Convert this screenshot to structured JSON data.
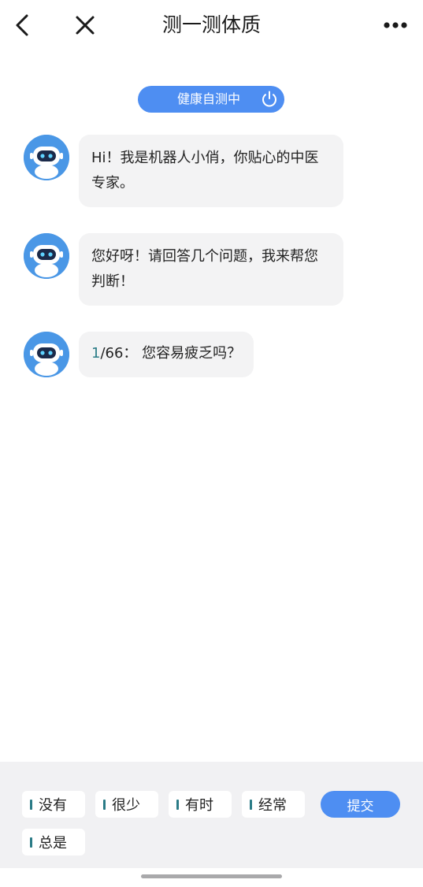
{
  "header": {
    "title": "测一测体质",
    "back_icon": "back-chevron-icon",
    "close_icon": "close-icon",
    "more_icon": "more-dots-icon"
  },
  "status": {
    "label": "健康自测中",
    "icon": "power-icon",
    "color": "#4e8ef2"
  },
  "messages": [
    {
      "sender": "robot",
      "avatar_icon": "robot-avatar-icon",
      "text": "Hi！我是机器人小俏，你贴心的中医专家。"
    },
    {
      "sender": "robot",
      "avatar_icon": "robot-avatar-icon",
      "text": "您好呀！请回答几个问题，我来帮您判断！"
    },
    {
      "sender": "robot",
      "avatar_icon": "robot-avatar-icon",
      "question_index": "1",
      "question_rest": "/66：  您容易疲乏吗？"
    }
  ],
  "options": [
    {
      "label": "没有"
    },
    {
      "label": "很少"
    },
    {
      "label": "有时"
    },
    {
      "label": "经常"
    },
    {
      "label": "总是"
    }
  ],
  "submit_label": "提交",
  "colors": {
    "accent": "#4e8ef2",
    "teal": "#2a7b86",
    "bubble_bg": "#f3f3f4",
    "panel_bg": "#f1f1f3"
  }
}
